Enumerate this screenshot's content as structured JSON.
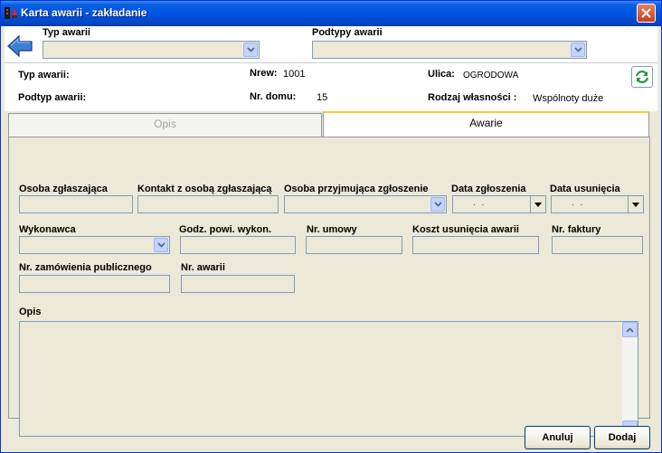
{
  "window": {
    "title": "Karta awarii - zakładanie",
    "icons": {
      "app": "app-icon",
      "close": "close-icon"
    }
  },
  "header": {
    "typ_awarii_label": "Typ awarii",
    "typ_awarii_value": "",
    "podtypy_awarii_label": "Podtypy awarii",
    "podtypy_awarii_value": "",
    "back_icon": "back-arrow-icon"
  },
  "info": {
    "typ_awarii_label": "Typ awarii:",
    "typ_awarii_value": "",
    "podtyp_awarii_label": "Podtyp awarii:",
    "podtyp_awarii_value": "",
    "nrew_label": "Nrew:",
    "nrew_value": "1001",
    "nr_domu_label": "Nr. domu:",
    "nr_domu_value": "15",
    "ulica_label": "Ulica:",
    "ulica_value": "OGRODOWA",
    "rodzaj_label": "Rodzaj własności :",
    "rodzaj_value": "Wspólnoty duże",
    "refresh_icon": "refresh-icon"
  },
  "tabs": [
    {
      "label": "Opis",
      "active": false
    },
    {
      "label": "Awarie",
      "active": true
    }
  ],
  "form": {
    "osoba_zglaszajaca": {
      "label": "Osoba zgłaszająca",
      "value": ""
    },
    "kontakt": {
      "label": "Kontakt z osobą zgłaszającą",
      "value": ""
    },
    "osoba_przyjmujaca": {
      "label": "Osoba przyjmująca zgłoszenie",
      "value": ""
    },
    "data_zgloszenia": {
      "label": "Data zgłoszenia",
      "value": ". ."
    },
    "data_usuniecia": {
      "label": "Data usunięcia",
      "value": ". ."
    },
    "wykonawca": {
      "label": "Wykonawca",
      "value": ""
    },
    "godz_powi": {
      "label": "Godz. powi. wykon.",
      "value": ""
    },
    "nr_umowy": {
      "label": "Nr. umowy",
      "value": ""
    },
    "koszt": {
      "label": "Koszt usunięcia awarii",
      "value": ""
    },
    "nr_faktury": {
      "label": "Nr. faktury",
      "value": ""
    },
    "nr_zamowienia": {
      "label": "Nr. zamówienia  publicznego",
      "value": ""
    },
    "nr_awarii": {
      "label": "Nr. awarii",
      "value": ""
    },
    "opis": {
      "label": "Opis",
      "value": ""
    }
  },
  "buttons": {
    "anuluj": "Anuluj",
    "dodaj": "Dodaj"
  },
  "colors": {
    "titlebar": "#0054e3",
    "face": "#ece9d8",
    "tab_accent": "#ffc73c",
    "field_border": "#7f9db9"
  }
}
